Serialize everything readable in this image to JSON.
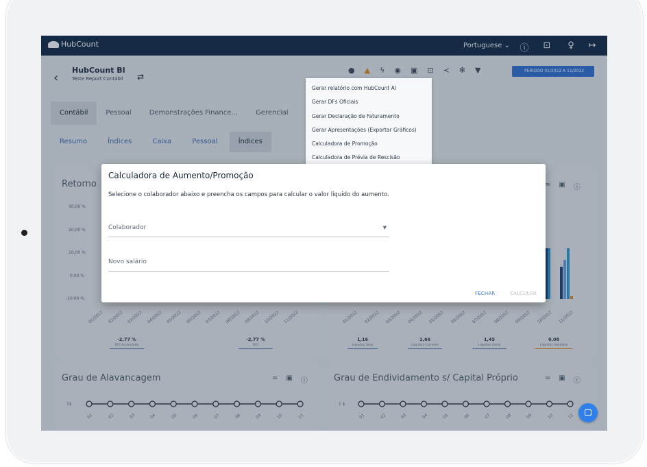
{
  "app": {
    "name": "HubCount"
  },
  "topbar": {
    "language": "Portuguese",
    "icons": [
      "help-icon",
      "unlock-icon",
      "lightbulb-icon",
      "logout-icon"
    ]
  },
  "header": {
    "title": "HubCount BI",
    "subtitle": "Teste Report Contábil",
    "period_button": "PERÍODO 01/2022 A 11/2022",
    "icons": [
      "location-pin-icon",
      "warning-icon",
      "bolt-icon",
      "eye-icon",
      "image-icon",
      "export-icon",
      "share-icon",
      "settings-icon",
      "filter-icon"
    ]
  },
  "main_tabs": [
    {
      "label": "Contábil"
    },
    {
      "label": "Pessoal"
    },
    {
      "label": "Demonstrações Finance..."
    },
    {
      "label": "Gerencial"
    }
  ],
  "sub_tabs": [
    {
      "label": "Resumo"
    },
    {
      "label": "Índices"
    },
    {
      "label": "Caixa"
    },
    {
      "label": "Pessoal"
    },
    {
      "label": "Índices"
    }
  ],
  "dropdown_menu": [
    "Gerar relatório com HubCount AI",
    "Gerar DFs Oficiais",
    "Gerar Declaração de Faturamento",
    "Gerar Apresentações (Exportar Gráficos)",
    "Calculadora de Promoção",
    "Calculadora de Prévia de Rescisão"
  ],
  "cards": {
    "roi": {
      "title": "Retorno",
      "y_ticks": [
        "30,00 %",
        "20,00 %",
        "10,00 %",
        "0,00 %",
        "-10,00 %"
      ],
      "metrics": [
        {
          "value": "-2,77 %",
          "label": "ROI Acumulado"
        },
        {
          "value": "-2,77 %",
          "label": "ROI"
        }
      ]
    },
    "liquidez": {
      "metrics": [
        {
          "value": "1,16",
          "label": "Liquidez Seca"
        },
        {
          "value": "1,66",
          "label": "Liquidez Corrente"
        },
        {
          "value": "1,45",
          "label": "Liquidez Geral"
        },
        {
          "value": "0,08",
          "label": "Liquidez Imediata"
        }
      ]
    },
    "alavancagem": {
      "title": "Grau de Alavancagem",
      "y_tick": "1$"
    },
    "endividamento": {
      "title": "Grau de Endividamento s/ Capital Próprio",
      "y_tick": "1 $"
    }
  },
  "x_months": [
    "01/2022",
    "02/2022",
    "03/2022",
    "04/2022",
    "05/2022",
    "06/2022",
    "07/2022",
    "08/2022",
    "09/2022",
    "10/2022",
    "11/2022"
  ],
  "x_short": [
    "01",
    "02",
    "03",
    "04",
    "05",
    "06",
    "07",
    "08",
    "09",
    "10",
    "11"
  ],
  "dialog": {
    "title": "Calculadora de Aumento/Promoção",
    "description": "Selecione o colaborador abaixo e preencha os campos para calcular o valor líquido do aumento.",
    "collaborator_label": "Colaborador",
    "salary_label": "Novo salário",
    "close_button": "FECHAR",
    "calculate_button": "CALCULAR"
  },
  "colors": {
    "topbar": "#0f2745",
    "accent": "#2f80ed",
    "close_button": "#3b73c9",
    "disabled_button": "#b9c0c8"
  }
}
